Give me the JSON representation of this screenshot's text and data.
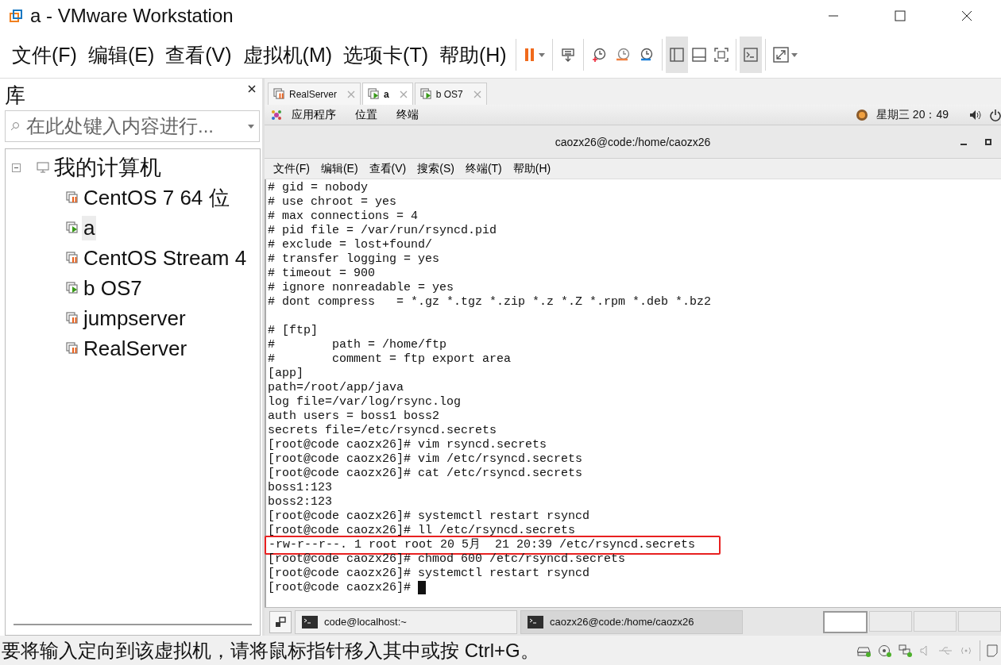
{
  "window": {
    "title": "a - VMware Workstation"
  },
  "menu": [
    "文件(F)",
    "编辑(E)",
    "查看(V)",
    "虚拟机(M)",
    "选项卡(T)",
    "帮助(H)"
  ],
  "toolbar": [
    {
      "kind": "pause",
      "selected": false
    },
    {
      "kind": "send-keys",
      "selected": false
    },
    {
      "kind": "snapshot",
      "selected": false
    },
    {
      "kind": "revert",
      "selected": false
    },
    {
      "kind": "manage",
      "selected": false
    },
    {
      "kind": "sidebar",
      "selected": true
    },
    {
      "kind": "thumbnails",
      "selected": false
    },
    {
      "kind": "fullscreen",
      "selected": false
    },
    {
      "kind": "console",
      "selected": true
    },
    {
      "kind": "stretch",
      "selected": false
    }
  ],
  "library": {
    "title": "库",
    "search": {
      "placeholder": "在此处键入内容进行..."
    },
    "tree": [
      {
        "label": "我的计算机",
        "expanded": true,
        "children": [
          {
            "label": "CentOS 7 64 位",
            "running": false,
            "selected": false
          },
          {
            "label": "a",
            "running": true,
            "selected": true
          },
          {
            "label": "CentOS Stream 4",
            "running": false,
            "selected": false
          },
          {
            "label": "b OS7",
            "running": true,
            "selected": false
          },
          {
            "label": "jumpserver",
            "running": false,
            "selected": false
          },
          {
            "label": "RealServer",
            "running": false,
            "selected": false
          }
        ]
      }
    ]
  },
  "vm_tabs": [
    {
      "label": "RealServer",
      "running": false,
      "selected": false
    },
    {
      "label": "a",
      "running": true,
      "selected": true
    },
    {
      "label": "b OS7",
      "running": true,
      "selected": false
    }
  ],
  "guest": {
    "topbar": {
      "menus": [
        "应用程序",
        "位置",
        "终端"
      ],
      "clock": "星期三 20：49"
    },
    "terminal": {
      "title": "caozx26@code:/home/caozx26",
      "menu": [
        "文件(F)",
        "编辑(E)",
        "查看(V)",
        "搜索(S)",
        "终端(T)",
        "帮助(H)"
      ],
      "lines": [
        {
          "text": "# gid = nobody"
        },
        {
          "text": "# use chroot = yes"
        },
        {
          "text": "# max connections = 4"
        },
        {
          "text": "# pid file = /var/run/rsyncd.pid"
        },
        {
          "text": "# exclude = lost+found/"
        },
        {
          "text": "# transfer logging = yes"
        },
        {
          "text": "# timeout = 900"
        },
        {
          "text": "# ignore nonreadable = yes"
        },
        {
          "text": "# dont compress   = *.gz *.tgz *.zip *.z *.Z *.rpm *.deb *.bz2"
        },
        {
          "text": "# [ftp]",
          "gap_before": true
        },
        {
          "text": "#        path = /home/ftp"
        },
        {
          "text": "#        comment = ftp export area"
        },
        {
          "text": "[app]"
        },
        {
          "text": "path=/root/app/java"
        },
        {
          "text": "log file=/var/log/rsync.log"
        },
        {
          "text": "auth users = boss1 boss2"
        },
        {
          "text": "secrets file=/etc/rsyncd.secrets"
        },
        {
          "text": "[root@code caozx26]# vim rsyncd.secrets"
        },
        {
          "text": "[root@code caozx26]# vim /etc/rsyncd.secrets"
        },
        {
          "text": "[root@code caozx26]# cat /etc/rsyncd.secrets"
        },
        {
          "text": "boss1:123"
        },
        {
          "text": "boss2:123"
        },
        {
          "text": "[root@code caozx26]# systemctl restart rsyncd"
        },
        {
          "text": "[root@code caozx26]# ll /etc/rsyncd.secrets"
        },
        {
          "text": "-rw-r--r--. 1 root root 20 5月  21 20:39 /etc/rsyncd.secrets",
          "highlighted": true
        },
        {
          "text": "[root@code caozx26]# chmod 600 /etc/rsyncd.secrets"
        },
        {
          "text": "[root@code caozx26]# systemctl restart rsyncd"
        },
        {
          "text": "[root@code caozx26]# ",
          "cursor": true
        }
      ]
    },
    "taskbar": {
      "tasks": [
        {
          "label": "code@localhost:~",
          "selected": false
        },
        {
          "label": "caozx26@code:/home/caozx26",
          "selected": true
        }
      ],
      "workspaces": [
        {
          "selected": true
        },
        {
          "selected": false
        },
        {
          "selected": false
        },
        {
          "selected": false
        }
      ]
    }
  },
  "status_bar": {
    "message": "要将输入定向到该虚拟机，请将鼠标指针移入其中或按 Ctrl+G。"
  }
}
